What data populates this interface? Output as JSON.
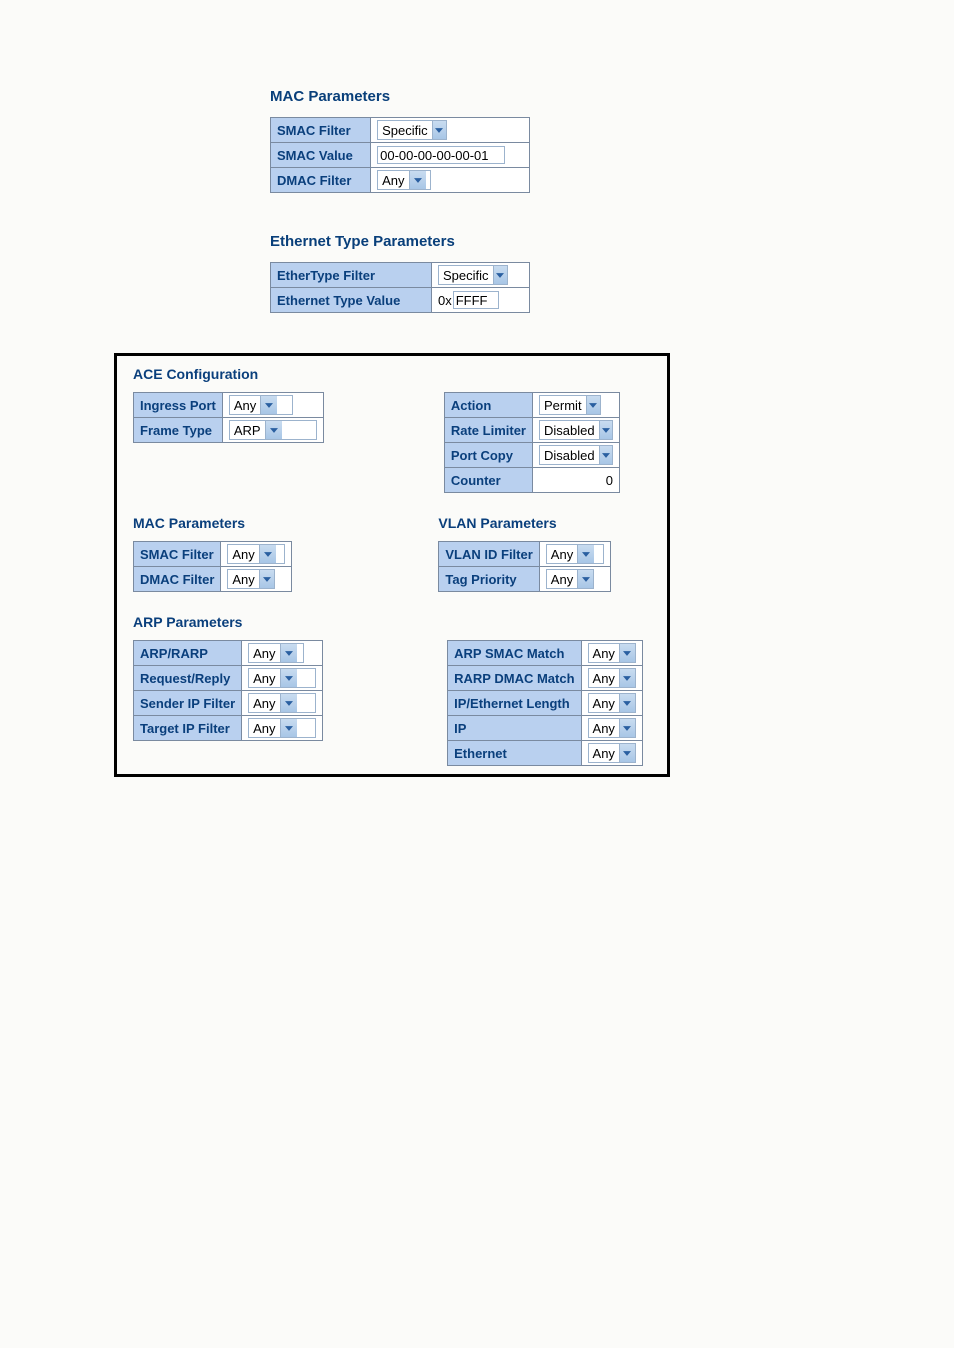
{
  "top_mac": {
    "title": "MAC Parameters",
    "smac_filter": {
      "label": "SMAC Filter",
      "value": "Specific"
    },
    "smac_value": {
      "label": "SMAC Value",
      "value": "00-00-00-00-00-01"
    },
    "dmac_filter": {
      "label": "DMAC Filter",
      "value": "Any"
    }
  },
  "top_eth": {
    "title": "Ethernet Type Parameters",
    "ethertype_filter": {
      "label": "EtherType Filter",
      "value": "Specific"
    },
    "eth_type_value": {
      "label": "Ethernet Type Value",
      "prefix": "0x",
      "value": "FFFF"
    }
  },
  "ace": {
    "title": "ACE Configuration",
    "left": {
      "ingress_port": {
        "label": "Ingress Port",
        "value": "Any"
      },
      "frame_type": {
        "label": "Frame Type",
        "value": "ARP"
      }
    },
    "right": {
      "action": {
        "label": "Action",
        "value": "Permit"
      },
      "rate_limiter": {
        "label": "Rate Limiter",
        "value": "Disabled"
      },
      "port_copy": {
        "label": "Port Copy",
        "value": "Disabled"
      },
      "counter": {
        "label": "Counter",
        "value": "0"
      }
    }
  },
  "mac2": {
    "title": "MAC Parameters",
    "smac_filter": {
      "label": "SMAC Filter",
      "value": "Any"
    },
    "dmac_filter": {
      "label": "DMAC Filter",
      "value": "Any"
    }
  },
  "vlan": {
    "title": "VLAN Parameters",
    "vlan_id_filter": {
      "label": "VLAN ID Filter",
      "value": "Any"
    },
    "tag_priority": {
      "label": "Tag Priority",
      "value": "Any"
    }
  },
  "arp": {
    "title": "ARP Parameters",
    "left": {
      "arp_rarp": {
        "label": "ARP/RARP",
        "value": "Any"
      },
      "request_reply": {
        "label": "Request/Reply",
        "value": "Any"
      },
      "sender_ip_filter": {
        "label": "Sender IP Filter",
        "value": "Any"
      },
      "target_ip_filter": {
        "label": "Target IP Filter",
        "value": "Any"
      }
    },
    "right": {
      "arp_smac_match": {
        "label": "ARP SMAC Match",
        "value": "Any"
      },
      "rarp_dmac_match": {
        "label": "RARP DMAC Match",
        "value": "Any"
      },
      "ip_eth_length": {
        "label": "IP/Ethernet Length",
        "value": "Any"
      },
      "ip": {
        "label": "IP",
        "value": "Any"
      },
      "ethernet": {
        "label": "Ethernet",
        "value": "Any"
      }
    }
  }
}
